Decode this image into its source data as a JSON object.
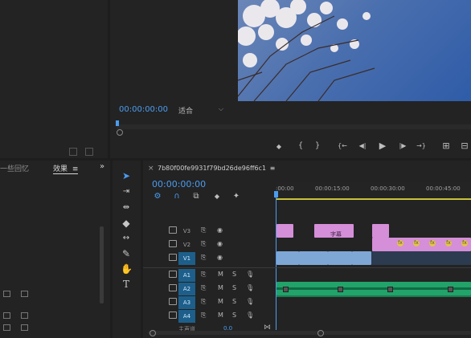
{
  "program_monitor": {
    "timecode": "00:00:00:00",
    "fit": "适合",
    "fit_caret": "⌵"
  },
  "transport": {
    "marker": "◆",
    "in": "{",
    "out": "}",
    "go_in": "{←",
    "step_back": "◀|",
    "play": "▶",
    "step_fwd": "|▶",
    "go_out": "→}",
    "insert": "⊞",
    "overwrite": "⊟"
  },
  "left_panel": {
    "tab1": "一些回忆",
    "tab2": "效果",
    "tab2_menu": "≡",
    "expand": "»"
  },
  "timeline": {
    "close": "×",
    "sequence_name": "7b80f00fe9931f79bd26de96ff6c1",
    "menu": "≡",
    "timecode": "00:00:00:00",
    "ruler": [
      ":00:00",
      "00:00:15:00",
      "00:00:30:00",
      "00:00:45:00"
    ],
    "tracks": [
      {
        "name": "V3",
        "mid": "⎘",
        "eye": "◉"
      },
      {
        "name": "V2",
        "mid": "⎘",
        "eye": "◉"
      },
      {
        "name": "V1",
        "mid": "⎘",
        "eye": "◉"
      },
      {
        "name": "A1",
        "mid": "⎘",
        "m": "M",
        "s": "S",
        "mic": "🎙"
      },
      {
        "name": "A2",
        "mid": "⎘",
        "m": "M",
        "s": "S",
        "mic": "🎙"
      },
      {
        "name": "A3",
        "mid": "⎘",
        "m": "M",
        "s": "S",
        "mic": "🎙"
      },
      {
        "name": "A4",
        "mid": "⎘",
        "m": "M",
        "s": "S",
        "mic": "🎙"
      }
    ],
    "v3_clip_title": "字幕",
    "fx_badge": "fx",
    "bottom_label": "主声道",
    "bottom_value": "0.0"
  },
  "colors": {
    "accent": "#4b9cf0",
    "clip_pink": "#d58ed8",
    "clip_video": "#7ea7d6",
    "clip_audio": "#22a36a",
    "track_on": "#1d5f8a"
  }
}
